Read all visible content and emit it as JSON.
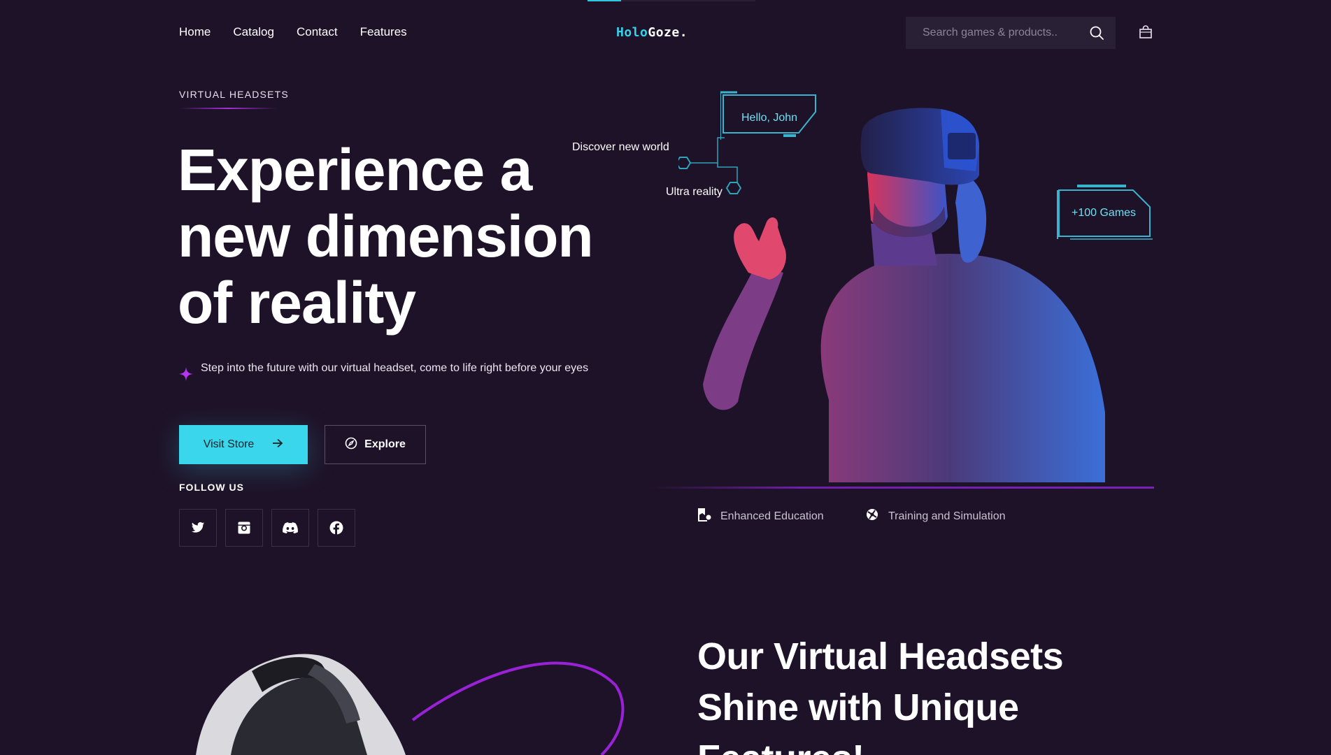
{
  "brand": {
    "part1": "Holo",
    "part2": "Goze.",
    "accent_color": "#34d2ec"
  },
  "nav": {
    "items": [
      "Home",
      "Catalog",
      "Contact",
      "Features"
    ]
  },
  "search": {
    "placeholder": "Search games & products.."
  },
  "hero": {
    "eyebrow": "VIRTUAL HEADSETS",
    "title_line1": "Experience a",
    "title_line2": "new dimension",
    "title_line3": "of reality",
    "description": "Step into the future with our virtual headset, come to life right before your eyes",
    "primary_button": "Visit Store",
    "secondary_button": "Explore",
    "follow_label": "FOLLOW US",
    "socials": [
      "twitter-icon",
      "instagram-icon",
      "discord-icon",
      "facebook-icon"
    ]
  },
  "visual": {
    "greeting": "Hello, John",
    "discover_label": "Discover new world",
    "ultra_label": "Ultra reality",
    "games_label": "+100 Games"
  },
  "features": [
    {
      "icon": "education-icon",
      "label": "Enhanced Education"
    },
    {
      "icon": "simulation-icon",
      "label": "Training and Simulation"
    }
  ],
  "section2": {
    "title_line1": "Our Virtual Headsets",
    "title_line2": "Shine with Unique",
    "title_line3": "Features!"
  },
  "colors": {
    "background": "#1e1228",
    "accent_cyan": "#3ad6ec",
    "accent_purple": "#a52ee0"
  }
}
